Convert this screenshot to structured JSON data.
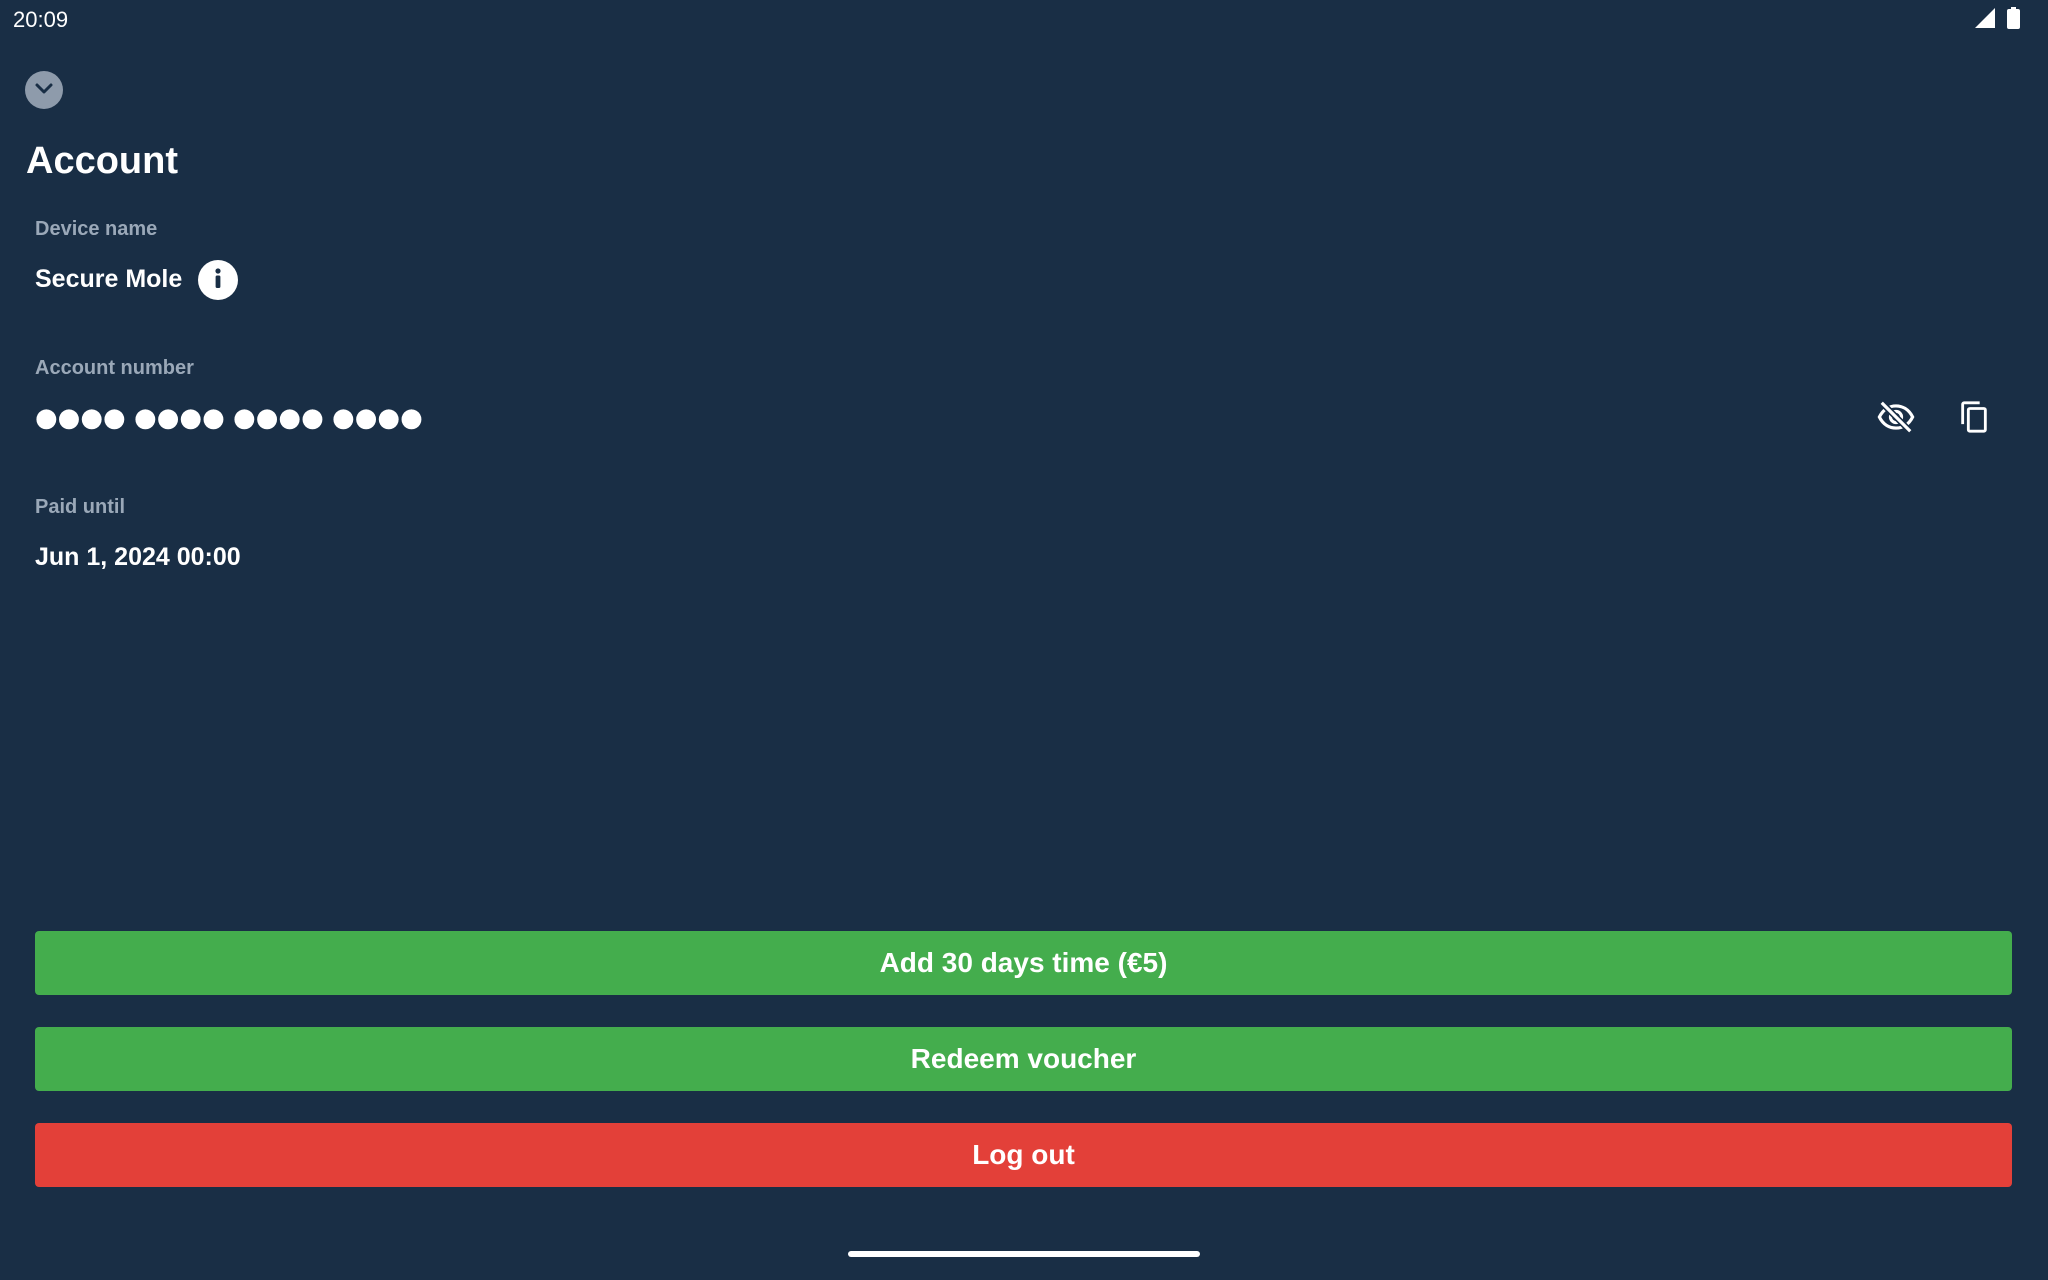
{
  "status_bar": {
    "time": "20:09",
    "icons": [
      "signal-icon",
      "battery-icon"
    ]
  },
  "header": {
    "collapse_icon": "chevron-down-icon"
  },
  "page": {
    "title": "Account"
  },
  "device": {
    "label": "Device name",
    "value": "Secure Mole",
    "info_icon": "info-icon"
  },
  "account_number": {
    "label": "Account number",
    "masked_value": "●●●● ●●●● ●●●● ●●●●",
    "visibility_icon": "eye-off-icon",
    "copy_icon": "copy-icon"
  },
  "paid_until": {
    "label": "Paid until",
    "value": "Jun 1, 2024 00:00"
  },
  "actions": {
    "add_time_label": "Add 30 days time (€5)",
    "redeem_label": "Redeem voucher",
    "logout_label": "Log out"
  },
  "colors": {
    "background": "#192e45",
    "success": "#44ad4d",
    "danger": "#e34039",
    "label": "#9aa8b8"
  }
}
